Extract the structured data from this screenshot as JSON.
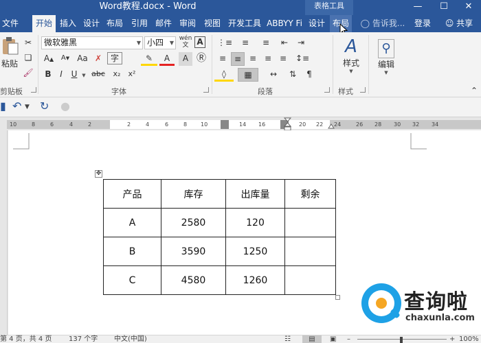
{
  "title_bar": {
    "title": "Word教程.docx - Word",
    "context_tab": "表格工具",
    "min_icon": "minimize-icon",
    "max_icon": "maximize-icon",
    "close_icon": "close-icon"
  },
  "tabs": {
    "file": "文件",
    "home": "开始",
    "insert": "插入",
    "design": "设计",
    "layout": "布局",
    "references": "引用",
    "mailings": "邮件",
    "review": "审阅",
    "view": "视图",
    "developer": "开发工具",
    "abbyy": "ABBYY Fi",
    "table_design": "设计",
    "table_layout": "布局",
    "tell_me": "告诉我...",
    "login": "登录",
    "share": "共享"
  },
  "ribbon": {
    "clipboard": {
      "paste": "粘贴",
      "label": "剪贴板"
    },
    "font": {
      "font_name": "微软雅黑",
      "font_size": "小四",
      "wen": "wén",
      "wen_char": "文",
      "A_frame": "A",
      "bold": "B",
      "italic": "I",
      "underline": "U",
      "strike": "abc",
      "subscript": "x₂",
      "superscript": "x²",
      "font_color": "A",
      "change_case": "Aa",
      "grow_font": "A",
      "shrink_font": "A",
      "char_border": "字",
      "label": "字体"
    },
    "paragraph": {
      "label": "段落"
    },
    "styles": {
      "button": "样式",
      "label": "样式"
    },
    "editing": {
      "button": "编辑"
    }
  },
  "ruler": {
    "left_marks": [
      "10",
      "8",
      "6",
      "4",
      "2"
    ],
    "right_marks": [
      "2",
      "4",
      "6",
      "8",
      "10",
      "12",
      "14",
      "16",
      "18",
      "20",
      "22",
      "24",
      "26",
      "28",
      "30",
      "32",
      "34"
    ]
  },
  "table": {
    "headers": [
      "产品",
      "库存",
      "出库量",
      "剩余"
    ],
    "rows": [
      [
        "A",
        "2580",
        "120",
        ""
      ],
      [
        "B",
        "3590",
        "1250",
        ""
      ],
      [
        "C",
        "4580",
        "1260",
        ""
      ]
    ]
  },
  "status_bar": {
    "page": "第 4 页，共 4 页",
    "words": "137 个字",
    "lang": "中文(中国)",
    "zoom": "100%"
  },
  "watermark": {
    "cn": "查询啦",
    "en": "chaxunla.com"
  },
  "colors": {
    "accent": "#2b579a",
    "ribbon_bg": "#f3f3f3",
    "watermark_blue": "#1ea1e6"
  }
}
